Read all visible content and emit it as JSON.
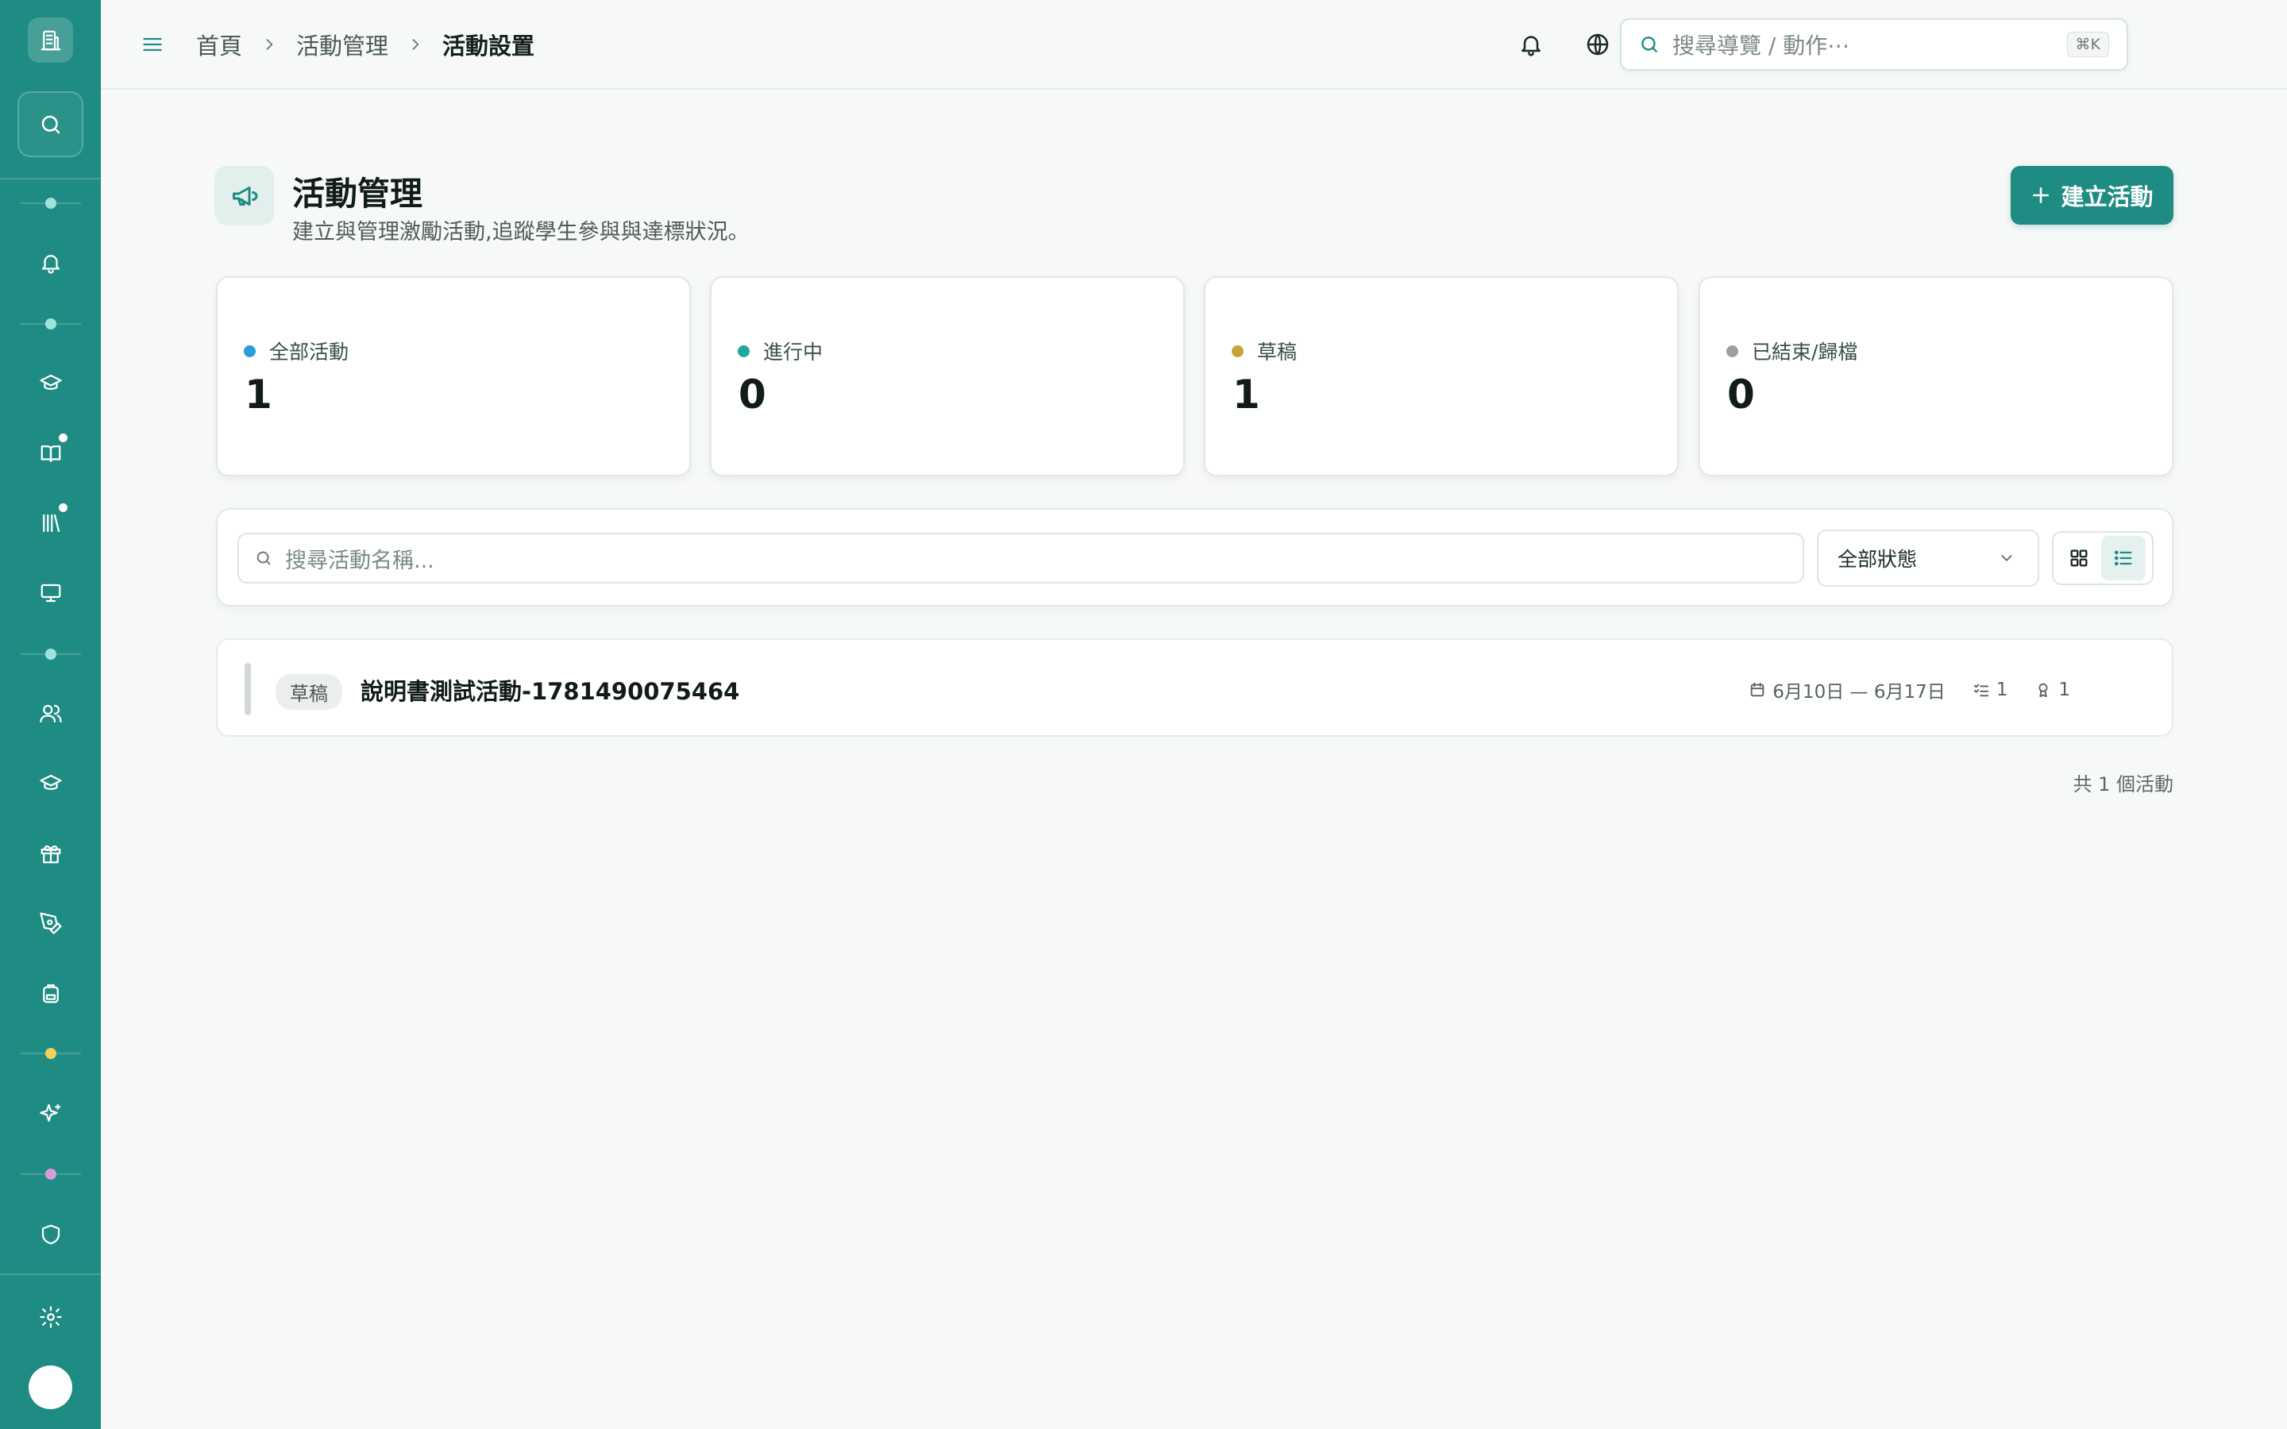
{
  "sidebar": {
    "logo_icon": "building-icon",
    "items": [
      {
        "name": "bell-icon"
      },
      {
        "name": "graduation-cap-icon"
      },
      {
        "name": "book-open-icon",
        "badge": true
      },
      {
        "name": "library-icon",
        "badge": true
      },
      {
        "name": "monitor-icon"
      },
      {
        "name": "users-icon"
      },
      {
        "name": "graduation-cap-icon"
      },
      {
        "name": "gift-icon"
      },
      {
        "name": "pen-tool-icon"
      },
      {
        "name": "backpack-icon"
      },
      {
        "name": "sparkles-icon"
      },
      {
        "name": "shield-icon"
      },
      {
        "name": "settings-icon"
      }
    ],
    "divider_colors": [
      "#9fe3dc",
      "#9fe3dc",
      "#9fe3dc",
      "#f2d15c",
      "#d89ad9"
    ]
  },
  "topbar": {
    "breadcrumb": [
      "首頁",
      "活動管理",
      "活動設置"
    ],
    "search_placeholder": "搜尋導覽 / 動作⋯",
    "shortcut": "⌘K"
  },
  "page": {
    "title": "活動管理",
    "subtitle": "建立與管理激勵活動,追蹤學生參與與達標狀況。",
    "create_button": "建立活動"
  },
  "stats": [
    {
      "label": "全部活動",
      "value": "1",
      "color": "#2a9fd6"
    },
    {
      "label": "進行中",
      "value": "0",
      "color": "#1fa99a"
    },
    {
      "label": "草稿",
      "value": "1",
      "color": "#c9a33a"
    },
    {
      "label": "已結束/歸檔",
      "value": "0",
      "color": "#9aa1a0"
    }
  ],
  "filters": {
    "search_placeholder": "搜尋活動名稱...",
    "status_selected": "全部狀態",
    "view_mode": "list"
  },
  "activities": [
    {
      "status": "草稿",
      "name": "說明書測試活動-1781490075464",
      "date_range": "6月10日 — 6月17日",
      "tasks": "1",
      "rewards": "1"
    }
  ],
  "footer": {
    "total": "共 1 個活動"
  },
  "colors": {
    "accent": "#1e8c82",
    "background": "#f6f9f8"
  }
}
